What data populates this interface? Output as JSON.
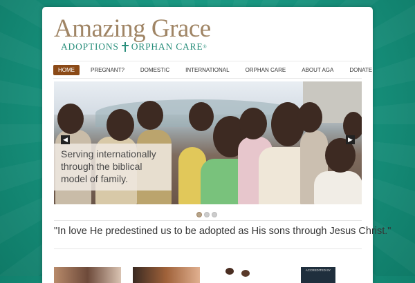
{
  "logo": {
    "title": "Amazing Grace",
    "subtitle_left": "ADOPTIONS",
    "subtitle_right": "ORPHAN CARE",
    "registered": "®"
  },
  "nav": {
    "items": [
      {
        "label": "HOME",
        "active": true
      },
      {
        "label": "PREGNANT?"
      },
      {
        "label": "DOMESTIC"
      },
      {
        "label": "INTERNATIONAL"
      },
      {
        "label": "ORPHAN CARE"
      },
      {
        "label": "ABOUT AGA"
      },
      {
        "label": "DONATE"
      }
    ]
  },
  "slider": {
    "caption": "Serving internationally through the biblical model of family.",
    "prev_icon": "arrow-left-icon",
    "next_icon": "arrow-right-icon",
    "dots": 3,
    "active_dot": 0
  },
  "quote": "\"In love He predestined us to be adopted as His sons through Jesus Christ.\"",
  "badge": {
    "text": "ACCREDITED BY"
  },
  "colors": {
    "background": "#17917c",
    "brand_brown": "#a08565",
    "brand_green": "#2a8f7c",
    "nav_active": "#8b4a17"
  }
}
